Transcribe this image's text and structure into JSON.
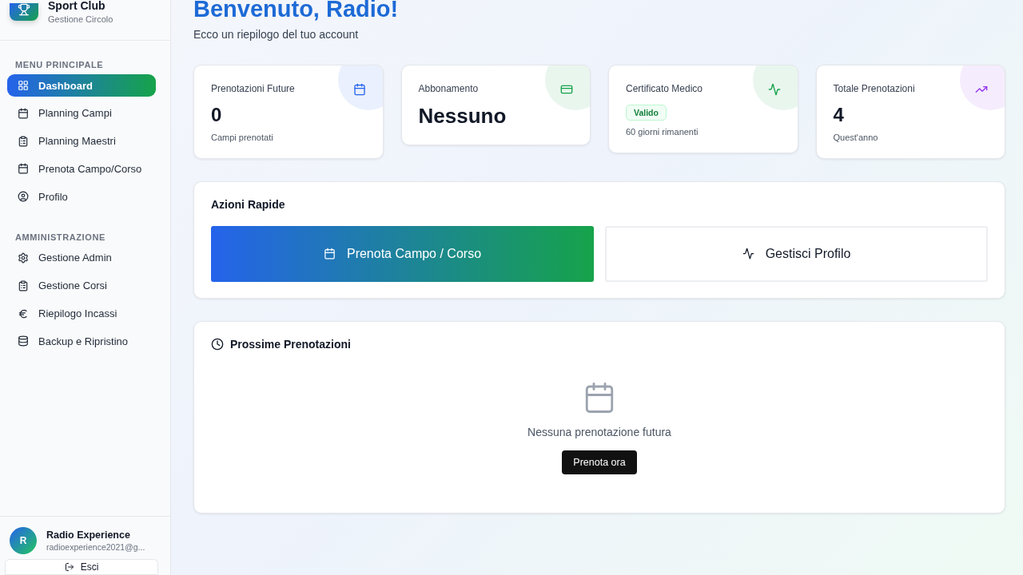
{
  "sidebar": {
    "brand": {
      "title": "Sport Club",
      "subtitle": "Gestione Circolo"
    },
    "sections": [
      {
        "heading": "MENU PRINCIPALE",
        "items": [
          {
            "label": "Dashboard",
            "selected": true
          },
          {
            "label": "Planning Campi",
            "selected": false
          },
          {
            "label": "Planning Maestri",
            "selected": false
          },
          {
            "label": "Prenota Campo/Corso",
            "selected": false
          },
          {
            "label": "Profilo",
            "selected": false
          }
        ]
      },
      {
        "heading": "AMMINISTRAZIONE",
        "items": [
          {
            "label": "Gestione Admin",
            "selected": false
          },
          {
            "label": "Gestione Corsi",
            "selected": false
          },
          {
            "label": "Riepilogo Incassi",
            "selected": false
          },
          {
            "label": "Backup e Ripristino",
            "selected": false
          }
        ]
      }
    ],
    "user": {
      "initial": "R",
      "name": "Radio Experience",
      "email": "radioexperience2021@g..."
    },
    "logout": "Esci"
  },
  "header": {
    "title": "Benvenuto, Radio!",
    "subtitle": "Ecco un riepilogo del tuo account"
  },
  "stats": [
    {
      "kind": "value",
      "label": "Prenotazioni Future",
      "value": "0",
      "note": "Campi prenotati",
      "color": "#2563eb"
    },
    {
      "kind": "value",
      "label": "Abbonamento",
      "value": "Nessuno",
      "color": "#16a34a"
    },
    {
      "kind": "badge",
      "label": "Certificato Medico",
      "badge": "Valido",
      "note": "60 giorni rimanenti",
      "color": "#16a34a"
    },
    {
      "kind": "value",
      "label": "Totale Prenotazioni",
      "value": "4",
      "note": "Quest'anno",
      "color": "#9333ea"
    }
  ],
  "quick_actions": {
    "title": "Azioni Rapide",
    "buttons": [
      {
        "label": "Prenota Campo / Corso",
        "kind": "primary"
      },
      {
        "label": "Gestisci Profilo",
        "kind": "outline"
      }
    ]
  },
  "upcoming": {
    "title": "Prossime Prenotazioni",
    "empty_text": "Nessuna prenotazione futura",
    "button": "Prenota ora"
  }
}
